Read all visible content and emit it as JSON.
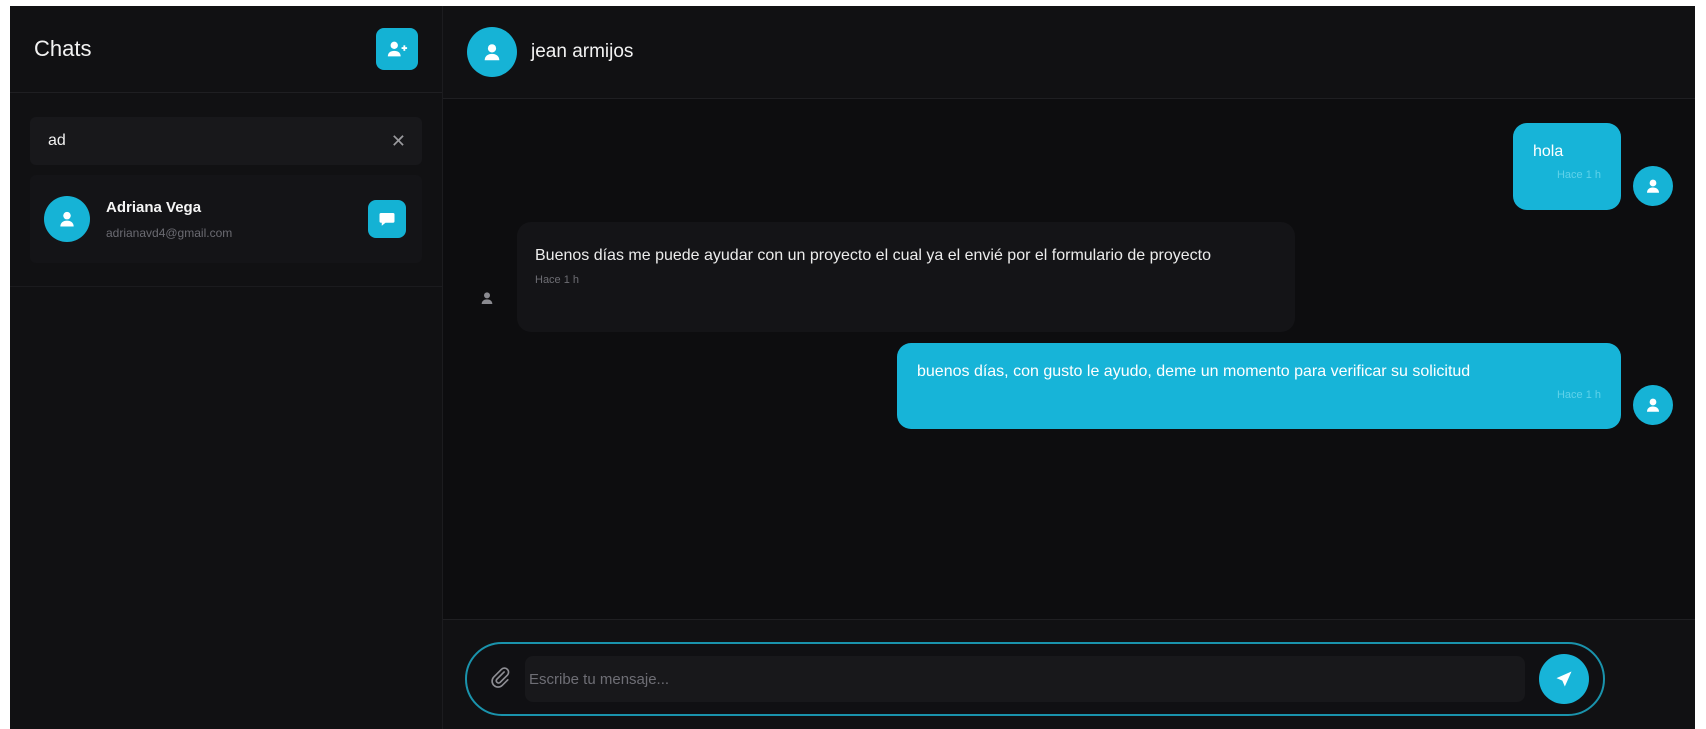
{
  "sidebar": {
    "title": "Chats",
    "new_contact_icon": "user-plus-icon",
    "search": {
      "value": "ad",
      "clear_icon": "close-icon"
    },
    "contacts": [
      {
        "name": "Adriana Vega",
        "email": "adrianavd4@gmail.com",
        "avatar_icon": "user-icon",
        "action_icon": "chat-bubble-icon"
      }
    ]
  },
  "chat": {
    "contact_name": "jean armijos",
    "messages": [
      {
        "direction": "outgoing",
        "text": "hola",
        "meta": "Hace 1 h"
      },
      {
        "direction": "incoming",
        "text": "Buenos días me puede ayudar con un proyecto el cual ya el envié por el formulario de proyecto",
        "meta": "Hace 1 h"
      },
      {
        "direction": "outgoing",
        "text": "buenos días, con gusto le ayudo, deme un momento para verificar su solicitud",
        "meta": "Hace 1 h"
      }
    ]
  },
  "composer": {
    "placeholder": "Escribe tu mensaje...",
    "attach_icon": "paperclip-icon",
    "send_icon": "send-icon"
  },
  "colors": {
    "accent": "#17b4d8",
    "background": "#0d0d0f",
    "panel": "#111113"
  }
}
